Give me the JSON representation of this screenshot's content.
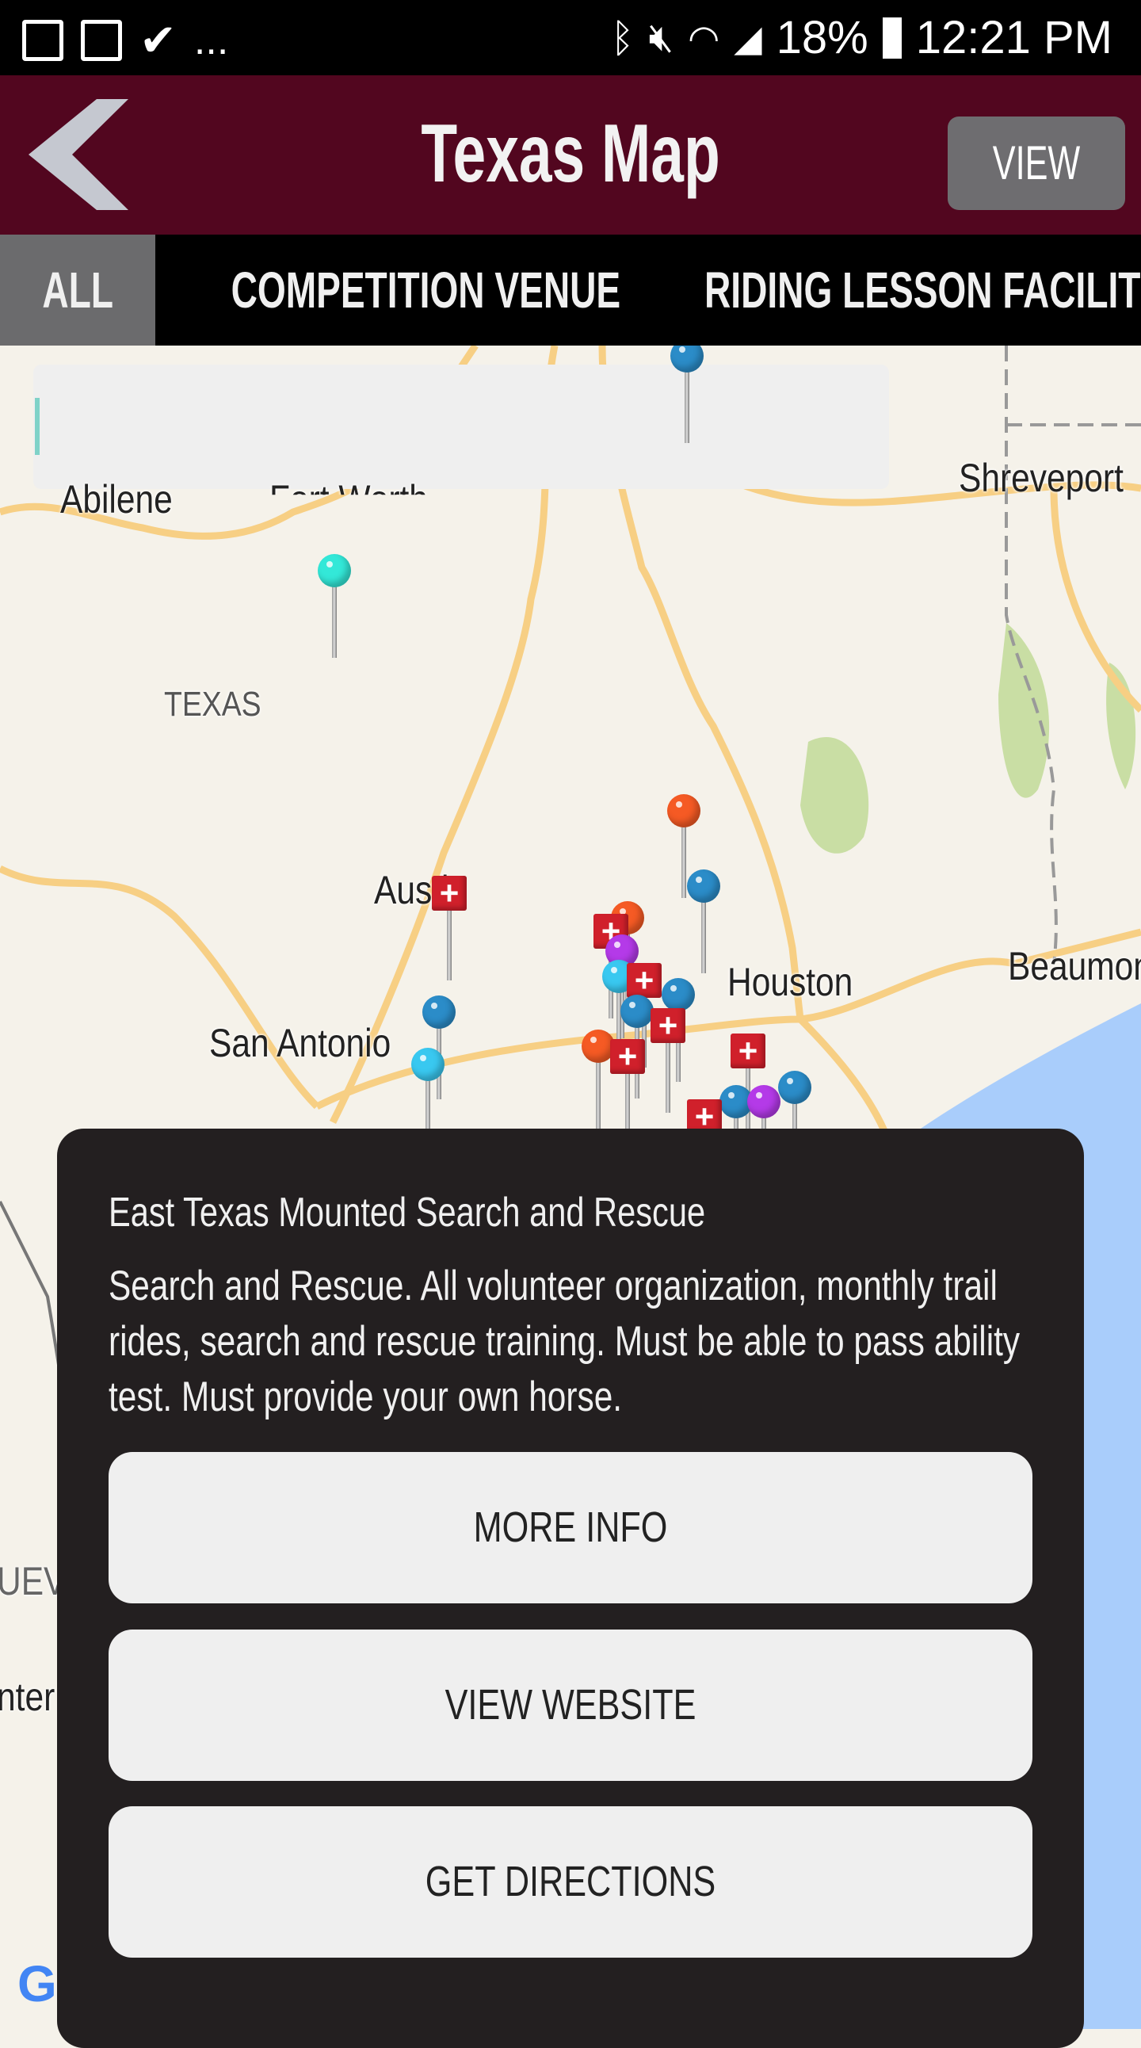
{
  "status_bar": {
    "left_icons": [
      "gmail-icon",
      "gallery-icon",
      "tasks-icon"
    ],
    "more": "...",
    "right_icons": [
      "bluetooth-icon",
      "mute-icon",
      "wifi-icon",
      "signal-icon",
      "battery-charging-icon"
    ],
    "battery": "18%",
    "time": "12:21 PM"
  },
  "header": {
    "title": "Texas Map",
    "view_list": "VIEW LIST",
    "back_icon": "chevron-left-icon",
    "color": "#52061f"
  },
  "tabs": [
    {
      "label": "ALL",
      "active": true
    },
    {
      "label": "COMPETITION VENUE"
    },
    {
      "label": "RIDING LESSON FACILITY"
    }
  ],
  "map": {
    "search": {
      "value": "",
      "placeholder": ""
    },
    "cities": [
      "Abilene",
      "Fort Worth",
      "Shreveport",
      "TEXAS",
      "Austin",
      "Houston",
      "San Antonio",
      "Beaumont",
      "UEV",
      "nter"
    ],
    "attribution": "G",
    "pin_colors": {
      "blue": "#2b8cc8",
      "cyan": "#39c8f0",
      "orange": "#f55a24",
      "purple": "#b43ae8",
      "red": "#d0202b",
      "teal": "#33e8d8"
    }
  },
  "panel": {
    "title": "East Texas Mounted Search and Rescue",
    "description": "Search and Rescue. All volunteer organization, monthly trail rides, search and rescue training. Must be able to pass ability test. Must provide your own horse.",
    "buttons": [
      "MORE INFO",
      "VIEW WEBSITE",
      "GET DIRECTIONS"
    ]
  }
}
